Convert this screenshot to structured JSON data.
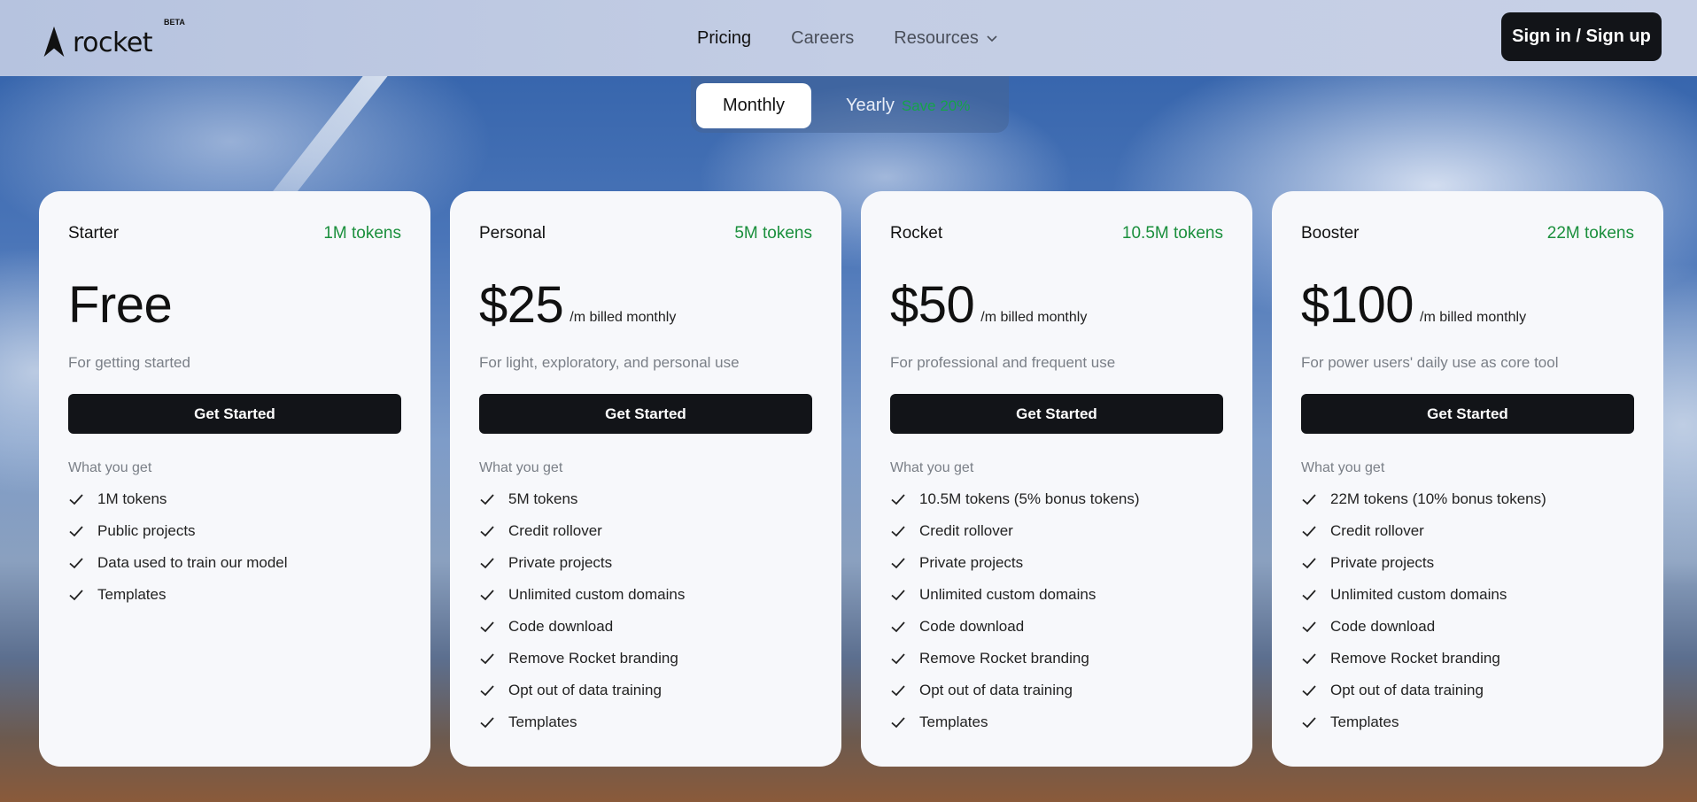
{
  "header": {
    "brand": "rocket",
    "beta_badge": "BETA",
    "nav": [
      {
        "label": "Pricing",
        "active": true
      },
      {
        "label": "Careers",
        "active": false
      },
      {
        "label": "Resources",
        "active": false,
        "icon": "chevron-down-icon"
      }
    ],
    "signin_label": "Sign in / Sign up"
  },
  "billing_toggle": {
    "monthly_label": "Monthly",
    "yearly_label": "Yearly",
    "yearly_badge": "Save 20%",
    "selected": "Monthly"
  },
  "plans": [
    {
      "name": "Starter",
      "tokens": "1M tokens",
      "price": "Free",
      "price_note": "",
      "description": "For getting started",
      "cta": "Get Started",
      "features_heading": "What you get",
      "features": [
        "1M tokens",
        "Public projects",
        "Data used to train our model",
        "Templates"
      ]
    },
    {
      "name": "Personal",
      "tokens": "5M tokens",
      "price": "$25",
      "price_note": "/m billed monthly",
      "description": "For light, exploratory, and personal use",
      "cta": "Get Started",
      "features_heading": "What you get",
      "features": [
        "5M tokens",
        "Credit rollover",
        "Private projects",
        "Unlimited custom domains",
        "Code download",
        "Remove Rocket branding",
        "Opt out of data training",
        "Templates"
      ]
    },
    {
      "name": "Rocket",
      "tokens": "10.5M tokens",
      "price": "$50",
      "price_note": "/m billed monthly",
      "description": "For professional and frequent use",
      "cta": "Get Started",
      "features_heading": "What you get",
      "features": [
        "10.5M tokens (5% bonus tokens)",
        "Credit rollover",
        "Private projects",
        "Unlimited custom domains",
        "Code download",
        "Remove Rocket branding",
        "Opt out of data training",
        "Templates"
      ]
    },
    {
      "name": "Booster",
      "tokens": "22M tokens",
      "price": "$100",
      "price_note": "/m billed monthly",
      "description": "For power users' daily use as core tool",
      "cta": "Get Started",
      "features_heading": "What you get",
      "features": [
        "22M tokens (10% bonus tokens)",
        "Credit rollover",
        "Private projects",
        "Unlimited custom domains",
        "Code download",
        "Remove Rocket branding",
        "Opt out of data training",
        "Templates"
      ]
    }
  ],
  "colors": {
    "accent_green": "#1a8f3c",
    "button_dark": "#121418"
  }
}
